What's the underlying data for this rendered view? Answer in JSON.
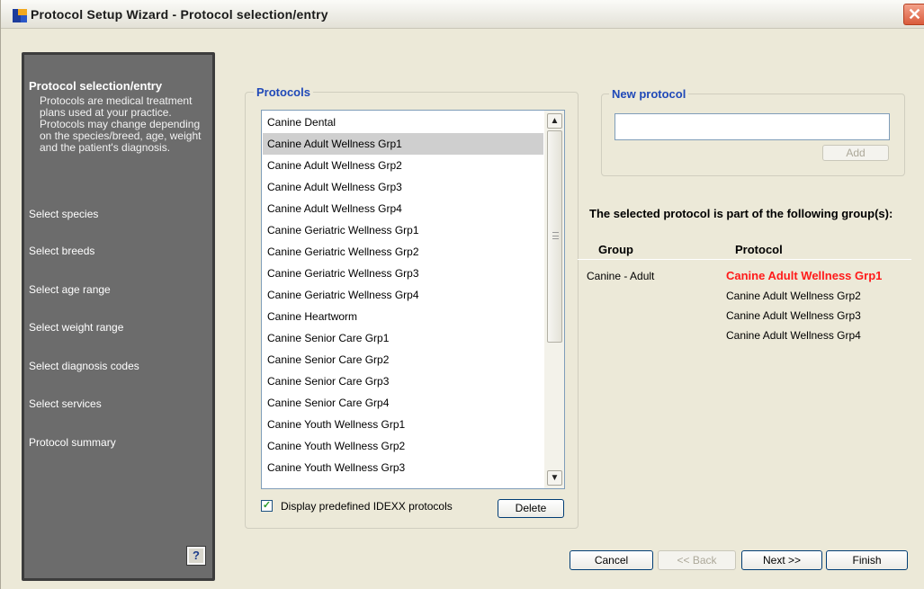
{
  "window": {
    "title": "Protocol Setup Wizard - Protocol selection/entry",
    "close_glyph": "✕"
  },
  "sidebar": {
    "heading": "Protocol selection/entry",
    "description": "Protocols are medical treatment plans used at your practice. Protocols may change depending on the species/breed, age, weight and the patient's diagnosis.",
    "steps": [
      "Select species",
      "Select breeds",
      "Select age range",
      "Select weight range",
      "Select diagnosis codes",
      "Select services",
      "Protocol summary"
    ],
    "help_glyph": "?"
  },
  "protocols": {
    "legend": "Protocols",
    "items": [
      "Canine Dental",
      "Canine Adult Wellness Grp1",
      "Canine Adult Wellness Grp2",
      "Canine Adult Wellness Grp3",
      "Canine Adult Wellness Grp4",
      "Canine Geriatric Wellness Grp1",
      "Canine Geriatric Wellness Grp2",
      "Canine Geriatric Wellness Grp3",
      "Canine Geriatric Wellness Grp4",
      "Canine Heartworm",
      "Canine Senior Care Grp1",
      "Canine Senior Care Grp2",
      "Canine Senior Care Grp3",
      "Canine Senior Care Grp4",
      "Canine Youth Wellness Grp1",
      "Canine Youth Wellness Grp2",
      "Canine Youth Wellness Grp3"
    ],
    "selected": "Canine Adult Wellness Grp1",
    "scroll_up_glyph": "▲",
    "scroll_down_glyph": "▼",
    "checkbox_label": "Display predefined IDEXX protocols",
    "checkbox_checked": true,
    "checkbox_glyph": "✓",
    "delete_label": "Delete"
  },
  "new_protocol": {
    "legend": "New protocol",
    "value": "",
    "add_label": "Add"
  },
  "groups": {
    "title": "The selected protocol is part of the following group(s):",
    "col_group": "Group",
    "col_protocol": "Protocol",
    "group_name": "Canine - Adult",
    "protocols": [
      "Canine Adult Wellness Grp1",
      "Canine Adult Wellness Grp2",
      "Canine Adult Wellness Grp3",
      "Canine Adult Wellness Grp4"
    ],
    "highlight_color": "#ff1a1a"
  },
  "footer": {
    "cancel_label": "Cancel",
    "back_label": "<< Back",
    "next_label": "Next >>",
    "finish_label": "Finish"
  }
}
